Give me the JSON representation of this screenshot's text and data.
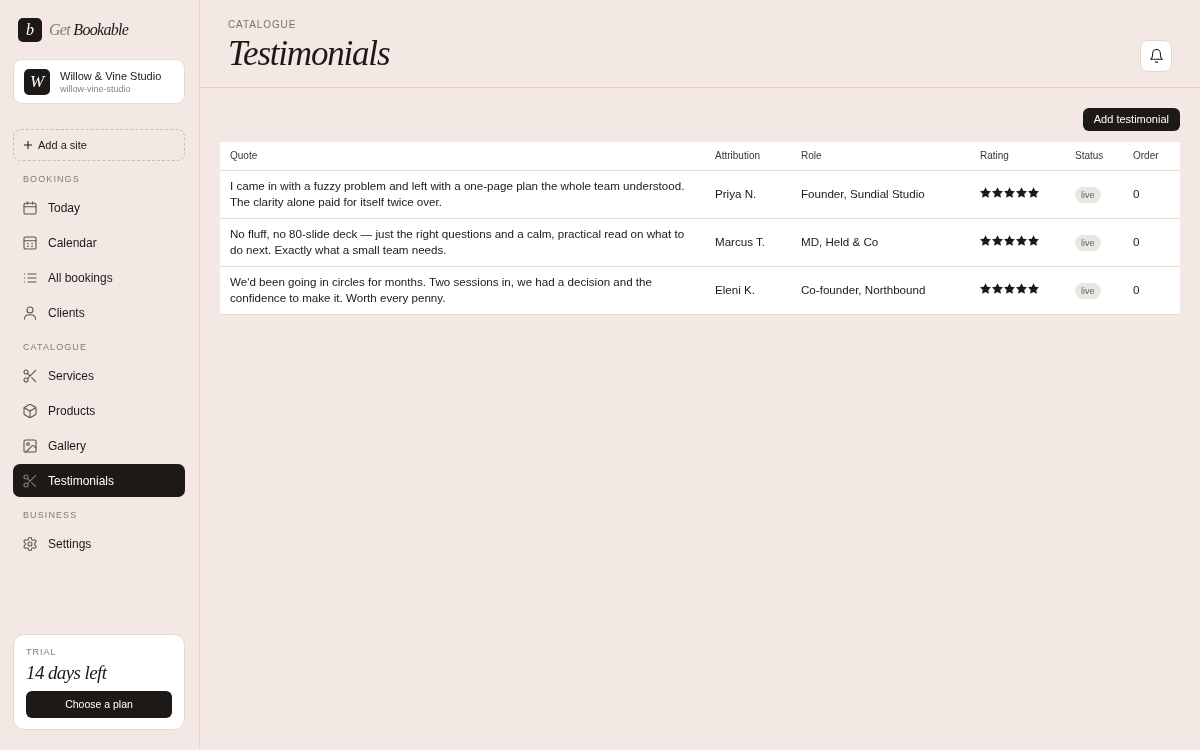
{
  "brand": {
    "mark": "b",
    "prefix": "Get",
    "name": "Bookable"
  },
  "site": {
    "initial": "W",
    "name": "Willow & Vine Studio",
    "slug": "willow-vine-studio"
  },
  "add_site": {
    "label": "Add a site"
  },
  "sidebar": {
    "sections": [
      {
        "label": "BOOKINGS",
        "items": [
          {
            "label": "Today",
            "selected": false
          },
          {
            "label": "Calendar",
            "selected": false
          },
          {
            "label": "All bookings",
            "selected": false
          },
          {
            "label": "Clients",
            "selected": false
          }
        ]
      },
      {
        "label": "CATALOGUE",
        "items": [
          {
            "label": "Services",
            "selected": false
          },
          {
            "label": "Products",
            "selected": false
          },
          {
            "label": "Gallery",
            "selected": false
          },
          {
            "label": "Testimonials",
            "selected": true
          }
        ]
      },
      {
        "label": "BUSINESS",
        "items": [
          {
            "label": "Settings",
            "selected": false
          }
        ]
      }
    ]
  },
  "trial": {
    "label": "TRIAL",
    "days_left": "14 days left",
    "button": "Choose a plan"
  },
  "header": {
    "eyebrow": "CATALOGUE",
    "title": "Testimonials"
  },
  "toolbar": {
    "button": "Add testimonial"
  },
  "table": {
    "columns": [
      "Quote",
      "Attribution",
      "Role",
      "Rating",
      "Status",
      "Order"
    ],
    "rows": [
      {
        "quote": "I came in with a fuzzy problem and left with a one-page plan the whole team understood. The clarity alone paid for itself twice over.",
        "attribution": "Priya N.",
        "role": "Founder, Sundial Studio",
        "stars": 5,
        "status": "live",
        "order": "0"
      },
      {
        "quote": "No fluff, no 80-slide deck — just the right questions and a calm, practical read on what to do next. Exactly what a small team needs.",
        "attribution": "Marcus T.",
        "role": "MD, Held & Co",
        "stars": 5,
        "status": "live",
        "order": "0"
      },
      {
        "quote": "We'd been going in circles for months. Two sessions in, we had a decision and the confidence to make it. Worth every penny.",
        "attribution": "Eleni K.",
        "role": "Co-founder, Northbound",
        "stars": 5,
        "status": "live",
        "order": "0"
      }
    ]
  }
}
